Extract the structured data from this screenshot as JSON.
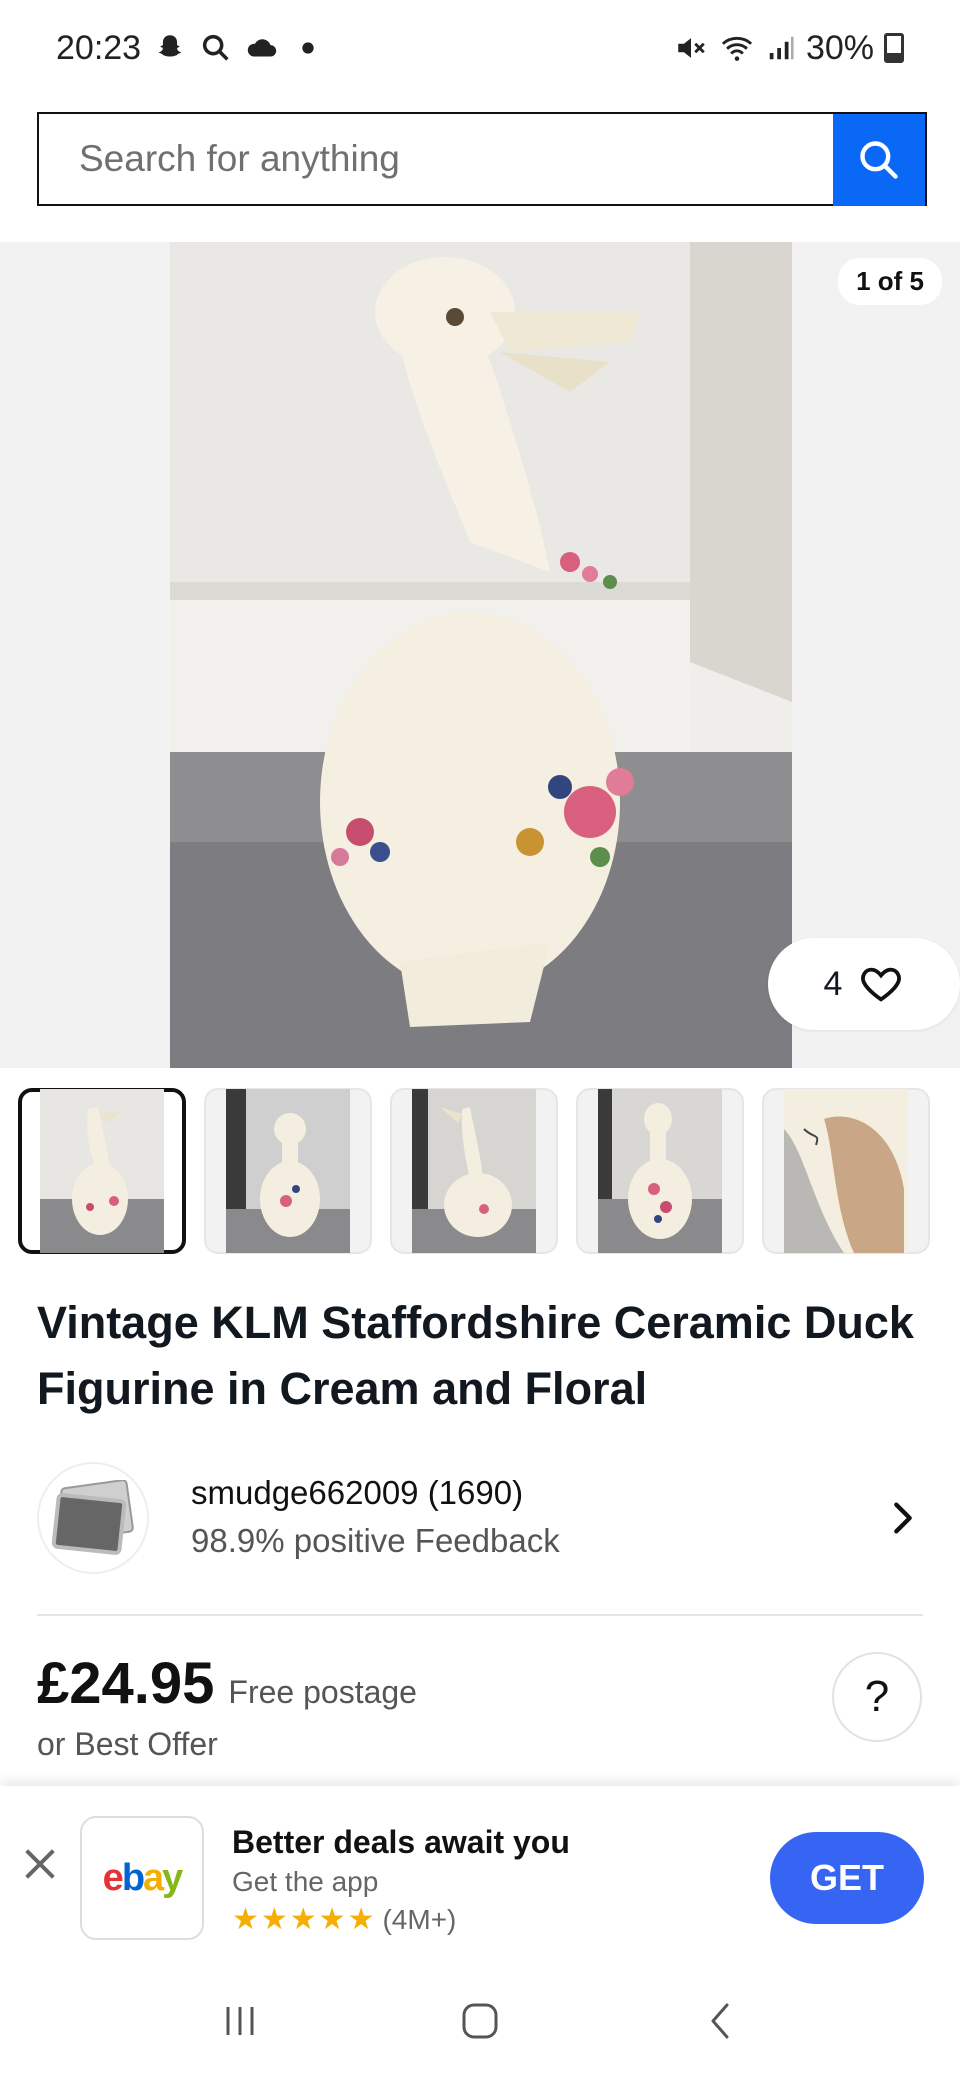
{
  "status_bar": {
    "time": "20:23",
    "battery": "30%"
  },
  "search": {
    "placeholder": "Search for anything"
  },
  "gallery": {
    "counter": "1 of 5",
    "watch_count": "4",
    "thumbnail_count": 5
  },
  "product": {
    "title": "Vintage KLM Staffordshire Ceramic Duck Figurine in Cream and Floral"
  },
  "seller": {
    "name": "smudge662009 (1690)",
    "feedback": "98.9% positive Feedback"
  },
  "price": {
    "amount": "£24.95",
    "postage": "Free postage",
    "offer": "or Best Offer"
  },
  "app_banner": {
    "title": "Better deals await you",
    "subtitle": "Get the app",
    "stars": "★★★★★",
    "rating_count": "(4M+)",
    "cta": "GET"
  },
  "colors": {
    "accent_blue": "#0968f6",
    "get_button": "#3665f3",
    "text_primary": "#111820",
    "text_secondary": "#555555"
  }
}
